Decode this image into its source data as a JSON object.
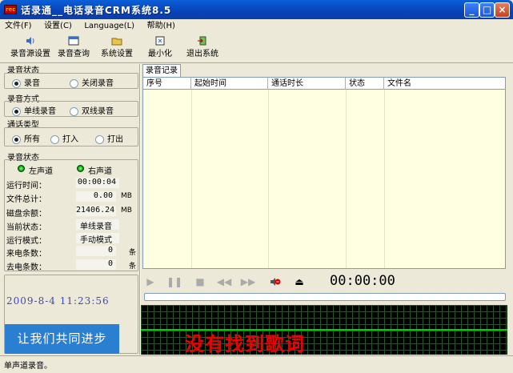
{
  "window": {
    "title": "话录通__电话录音CRM系统8.5",
    "app_icon": "rec-icon"
  },
  "menu": [
    "文件(F)",
    "设置(C)",
    "Language(L)",
    "帮助(H)"
  ],
  "toolbar": [
    {
      "label": "录音源设置",
      "icon": "speaker-icon"
    },
    {
      "label": "录音查询",
      "icon": "window-icon"
    },
    {
      "label": "系统设置",
      "icon": "folder-icon"
    },
    {
      "label": "最小化",
      "icon": "minimize-icon"
    },
    {
      "label": "退出系统",
      "icon": "exit-icon"
    }
  ],
  "record_state": {
    "title": "录音状态",
    "opt1": "录音",
    "opt2": "关闭录音",
    "selected": "录音"
  },
  "record_mode": {
    "title": "录音方式",
    "opt1": "单线录音",
    "opt2": "双线录音",
    "selected": "单线录音"
  },
  "call_type": {
    "title": "通话类型",
    "opt1": "所有",
    "opt2": "打入",
    "opt3": "打出",
    "selected": "所有"
  },
  "status": {
    "title": "录音状态",
    "left_channel": "左声道",
    "right_channel": "右声道",
    "rows": [
      {
        "label": "运行时间：",
        "value": "00:00:04",
        "unit": ""
      },
      {
        "label": "文件总计：",
        "value": "0.00",
        "unit": "MB"
      },
      {
        "label": "磁盘余额：",
        "value": "21406.24",
        "unit": "MB"
      },
      {
        "label": "当前状态：",
        "value": "单线录音",
        "unit": ""
      },
      {
        "label": "运行模式：",
        "value": "手动模式",
        "unit": ""
      },
      {
        "label": "来电条数：",
        "value": "0",
        "unit": "条"
      },
      {
        "label": "去电条数：",
        "value": "0",
        "unit": "条"
      }
    ]
  },
  "datetime": "2009-8-4   11:23:56",
  "slogan": "让我们共同进步",
  "records": {
    "tab": "录音记录",
    "columns": [
      "序号",
      "起始时间",
      "通话时长",
      "状态",
      "文件名"
    ]
  },
  "player": {
    "time": "00:00:00"
  },
  "lyrics": "没有找到歌词",
  "statusbar": "单声道录音。",
  "colors": {
    "titlebar": "#0A5FD8",
    "lyric_text": "#E00000",
    "grid": "#1E5A2A",
    "table_bg": "#FFFFE1"
  }
}
